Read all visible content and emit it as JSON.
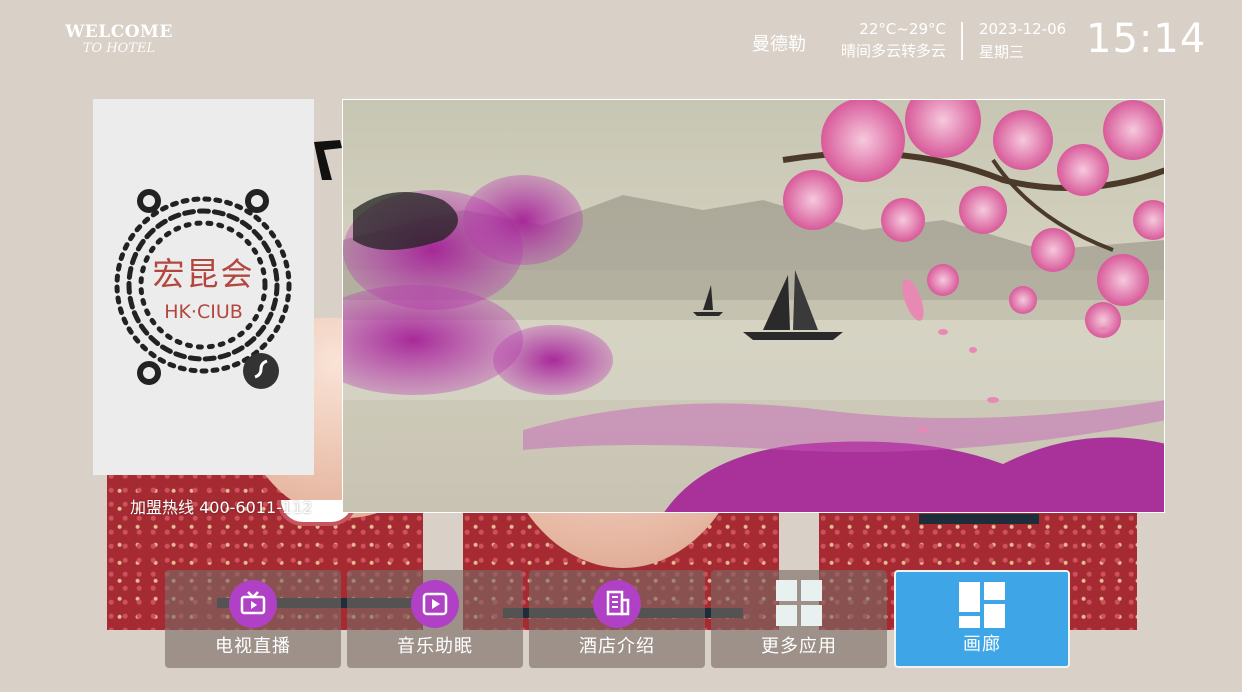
{
  "brand": {
    "line1": "WELCOME",
    "line2": "TO HOTEL"
  },
  "header": {
    "city": "曼德勒",
    "temperature": "22°C~29°C",
    "weather_desc": "晴间多云转多云",
    "date": "2023-12-06",
    "weekday": "星期三",
    "time": "15:14"
  },
  "qr": {
    "brand_cn": "宏昆会",
    "brand_en": "HK·CIUB"
  },
  "hotline": "加盟热线 400-6011-112",
  "nav": {
    "items": [
      {
        "label": "电视直播",
        "icon": "tv-icon"
      },
      {
        "label": "音乐助眠",
        "icon": "play-icon"
      },
      {
        "label": "酒店介绍",
        "icon": "building-icon"
      },
      {
        "label": "更多应用",
        "icon": "app-grid-icon"
      },
      {
        "label": "画廊",
        "icon": "gallery-icon",
        "active": true
      }
    ]
  },
  "colors": {
    "background": "#d9d0c7",
    "accent_active": "#3ea6e6",
    "icon_circle": "#b040c6",
    "qr_brand": "#b3473f"
  }
}
